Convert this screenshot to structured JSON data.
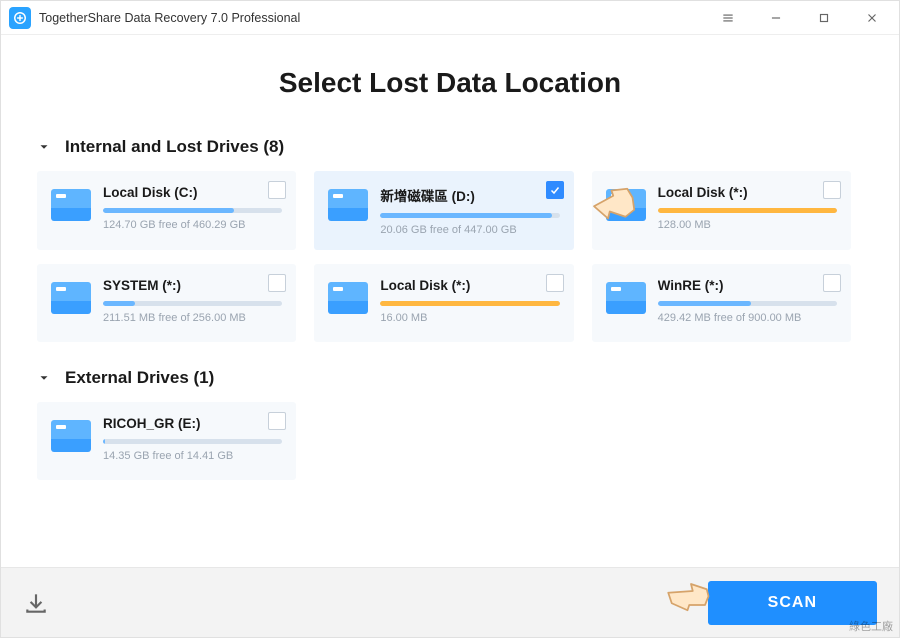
{
  "app": {
    "title": "TogetherShare Data Recovery 7.0 Professional"
  },
  "page": {
    "heading": "Select Lost Data Location"
  },
  "sections": {
    "internal": {
      "label": "Internal and Lost Drives (8)"
    },
    "external": {
      "label": "External Drives (1)"
    }
  },
  "drives_internal": [
    {
      "name": "Local Disk (C:)",
      "free": "124.70 GB free of 460.29 GB",
      "fill_pct": 73,
      "color": "blue",
      "selected": false,
      "icon": "windows"
    },
    {
      "name": "新增磁碟區 (D:)",
      "free": "20.06 GB free of 447.00 GB",
      "fill_pct": 96,
      "color": "blue",
      "selected": true,
      "icon": "drive"
    },
    {
      "name": "Local Disk (*:)",
      "free": "128.00 MB",
      "fill_pct": 100,
      "color": "amber",
      "selected": false,
      "icon": "drive"
    },
    {
      "name": "SYSTEM (*:)",
      "free": "211.51 MB free of 256.00 MB",
      "fill_pct": 18,
      "color": "blue",
      "selected": false,
      "icon": "drive"
    },
    {
      "name": "Local Disk (*:)",
      "free": "16.00 MB",
      "fill_pct": 100,
      "color": "amber",
      "selected": false,
      "icon": "drive"
    },
    {
      "name": "WinRE (*:)",
      "free": "429.42 MB free of 900.00 MB",
      "fill_pct": 52,
      "color": "blue",
      "selected": false,
      "icon": "drive"
    }
  ],
  "drives_external": [
    {
      "name": "RICOH_GR (E:)",
      "free": "14.35 GB free of 14.41 GB",
      "fill_pct": 1,
      "color": "blue",
      "selected": false,
      "icon": "usb"
    }
  ],
  "footer": {
    "scan_label": "SCAN"
  },
  "watermark": "綠色工廠"
}
